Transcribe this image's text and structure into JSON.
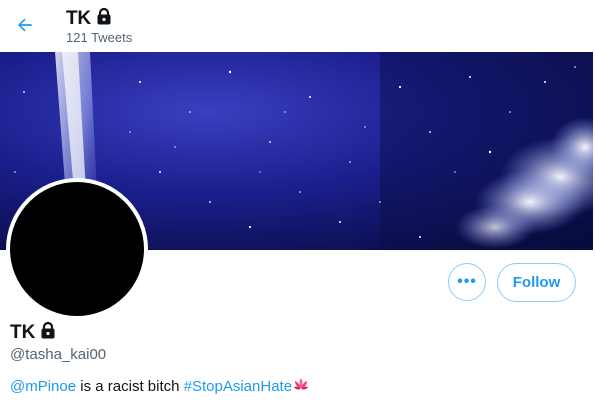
{
  "header": {
    "name": "TK",
    "tweet_count": "121 Tweets"
  },
  "profile": {
    "name": "TK",
    "handle": "@tasha_kai00"
  },
  "actions": {
    "more_label": "•••",
    "follow_label": "Follow"
  },
  "bio": {
    "mention": "@mPinoe",
    "text": " is a racist bitch ",
    "hashtag": "#StopAsianHate"
  },
  "colors": {
    "accent": "#1d9bf0",
    "secondary_text": "#536471",
    "banner_base": "#0b0f55"
  },
  "icons": {
    "back": "arrow-left-icon",
    "lock": "lock-icon",
    "lotus": "lotus-emoji-icon"
  }
}
